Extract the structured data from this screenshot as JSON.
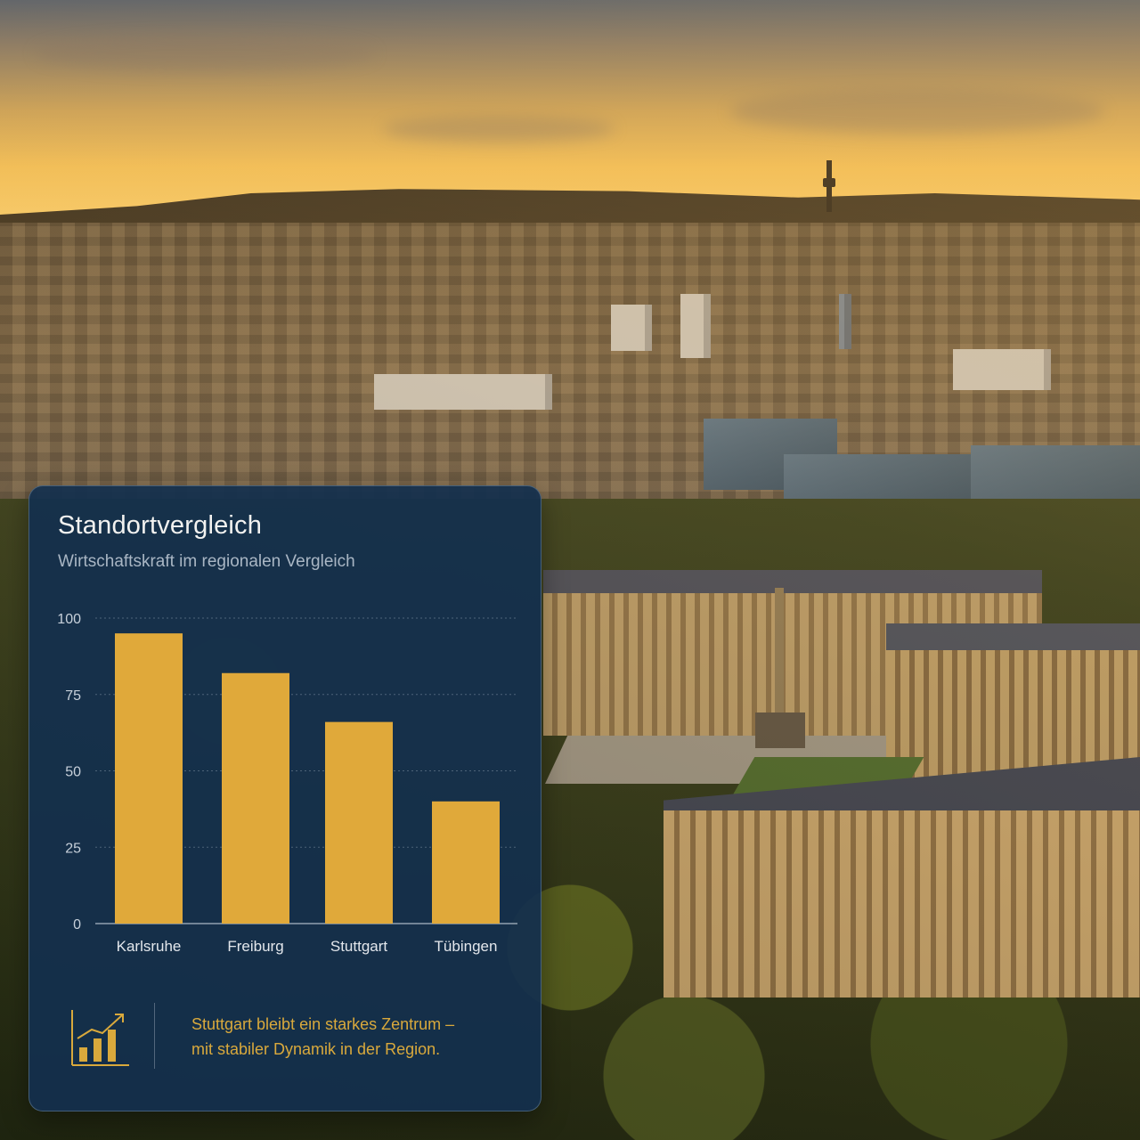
{
  "card": {
    "title": "Standortvergleich",
    "subtitle": "Wirtschaftskraft im regionalen Vergleich",
    "footer_line1": "Stuttgart bleibt ein starkes Zentrum –",
    "footer_line2": "mit stabiler Dynamik in der Region.",
    "footer_icon": "bar-chart-trend-icon"
  },
  "colors": {
    "card_background": "#132f4d",
    "bar": "#e0a93a",
    "accent_text": "#d9a93c"
  },
  "chart_data": {
    "type": "bar",
    "title": "Standortvergleich",
    "subtitle": "Wirtschaftskraft im regionalen Vergleich",
    "categories": [
      "Karlsruhe",
      "Freiburg",
      "Stuttgart",
      "Tübingen"
    ],
    "values": [
      95,
      82,
      66,
      40
    ],
    "yticks": [
      0,
      25,
      50,
      75,
      100
    ],
    "ylim": [
      0,
      100
    ],
    "xlabel": "",
    "ylabel": "",
    "grid": true,
    "legend": "none"
  }
}
